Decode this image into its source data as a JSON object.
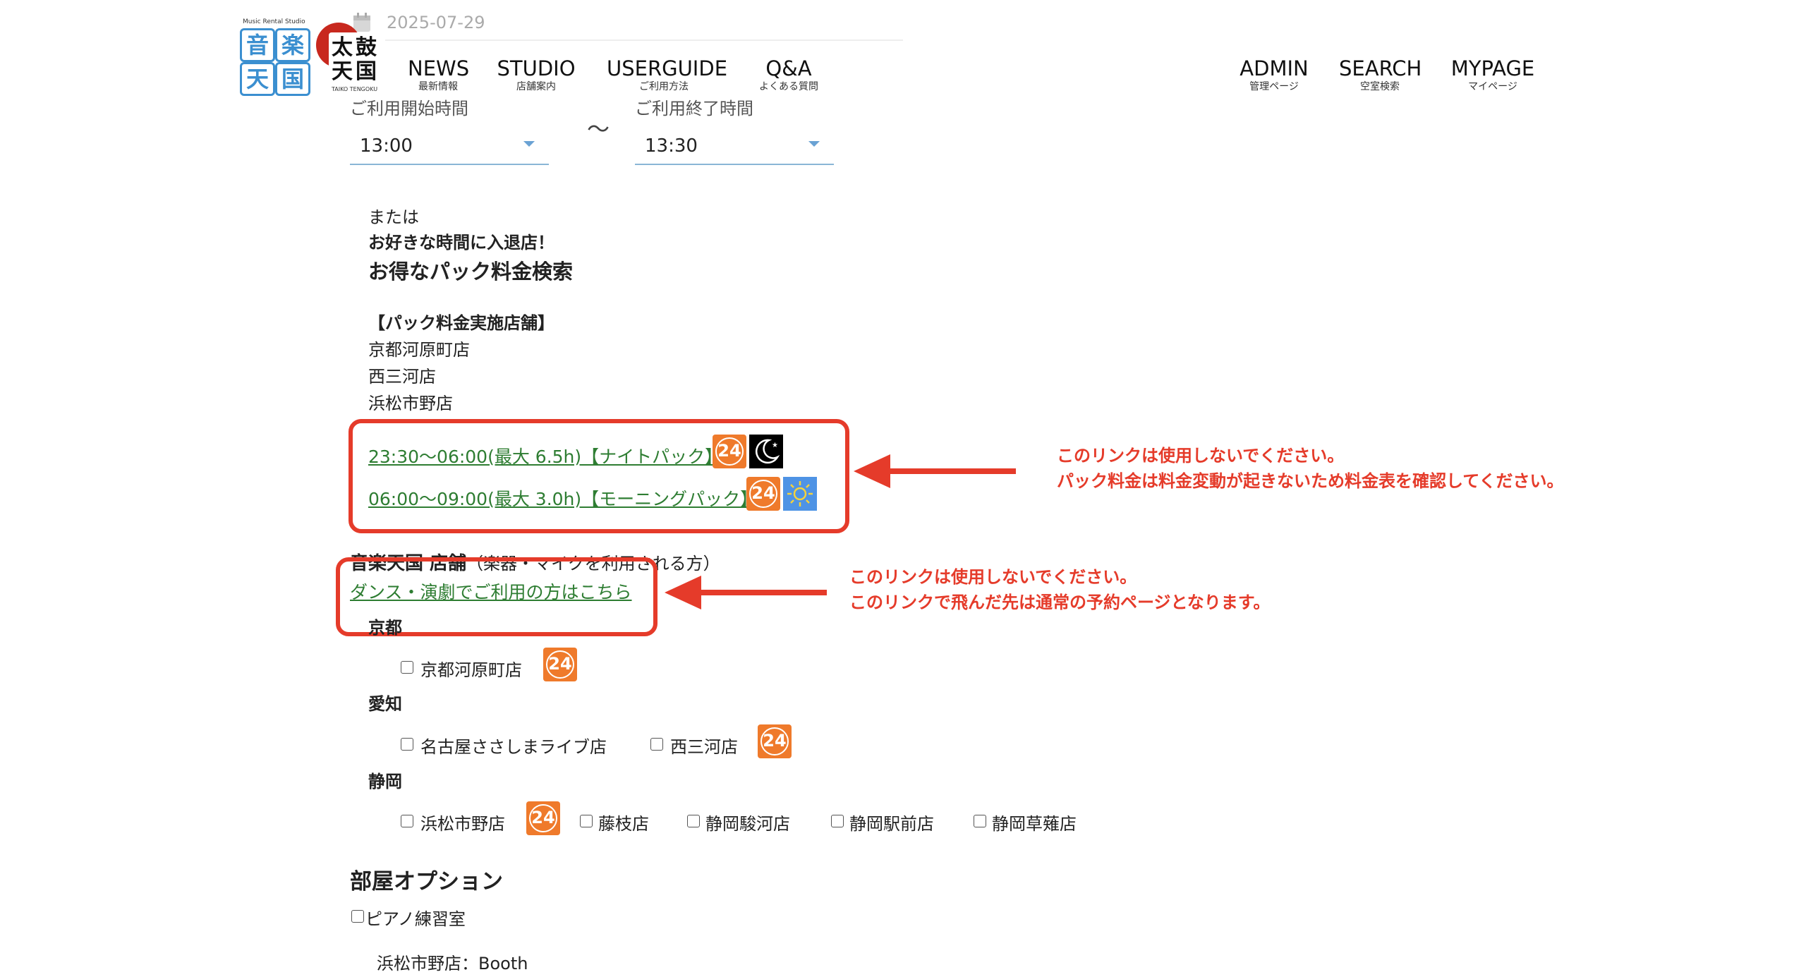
{
  "header": {
    "date": "2025-07-29",
    "logos": {
      "gakki_small": "Music Rental Studio",
      "gakki_chars": [
        "音",
        "楽",
        "天",
        "国"
      ],
      "taiko_chars": [
        "太",
        "鼓",
        "天",
        "国"
      ],
      "taiko_small": "TAIKO TENGOKU"
    },
    "nav_left": [
      {
        "label": "NEWS",
        "sub": "最新情報"
      },
      {
        "label": "STUDIO",
        "sub": "店舗案内"
      },
      {
        "label": "USERGUIDE",
        "sub": "ご利用方法"
      },
      {
        "label": "Q&A",
        "sub": "よくある質問"
      }
    ],
    "nav_right": [
      {
        "label": "ADMIN",
        "sub": "管理ページ"
      },
      {
        "label": "SEARCH",
        "sub": "空室検索"
      },
      {
        "label": "MYPAGE",
        "sub": "マイページ"
      }
    ]
  },
  "time": {
    "start_label": "ご利用開始時間",
    "end_label": "ご利用終了時間",
    "start_value": "13:00",
    "end_value": "13:30",
    "separator": "〜"
  },
  "pack": {
    "or": "または",
    "lead": "お好きな時間に入退店！",
    "title": "お得なパック料金検索",
    "stores_heading": "【パック料金実施店舗】",
    "stores": [
      "京都河原町店",
      "西三河店",
      "浜松市野店"
    ],
    "links": [
      {
        "label": "23:30〜06:00(最大 6.5h)【ナイトパック】",
        "icon": "moon-icon"
      },
      {
        "label": "06:00〜09:00(最大 3.0h)【モーニングパック】",
        "icon": "sun-icon"
      }
    ],
    "badge": "24"
  },
  "stores_section": {
    "title": "音楽天国 店舗",
    "title_note": "（楽器・マイクを利用される方）",
    "dance_link": "ダンス・演劇でご利用の方はこちら",
    "regions": [
      {
        "name": "京都",
        "stores": [
          "京都河原町店"
        ]
      },
      {
        "name": "愛知",
        "stores": [
          "名古屋ささしまライブ店",
          "西三河店"
        ]
      },
      {
        "name": "静岡",
        "stores": [
          "浜松市野店",
          "藤枝店",
          "静岡駿河店",
          "静岡駅前店",
          "静岡草薙店"
        ]
      }
    ]
  },
  "room_options": {
    "title": "部屋オプション",
    "piano": "ピアノ練習室",
    "booth": "浜松市野店：Booth"
  },
  "annotations": {
    "note1_line1": "このリンクは使用しないでください。",
    "note1_line2": "パック料金は料金変動が起きないため料金表を確認してください。",
    "note2_line1": "このリンクは使用しないでください。",
    "note2_line2": "このリンクで飛んだ先は通常の予約ページとなります。"
  },
  "colors": {
    "link": "#2e7d32",
    "annotation": "#e53b2a",
    "badge": "#ef7a2b",
    "select_underline": "#8ab6d6"
  }
}
